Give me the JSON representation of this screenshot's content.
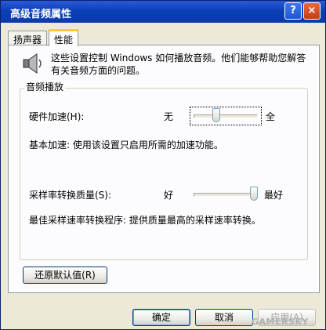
{
  "window": {
    "title": "高级音频属性",
    "help_button": "?",
    "close_button": "×"
  },
  "tabs": [
    {
      "label": "扬声器",
      "active": false
    },
    {
      "label": "性能",
      "active": true
    }
  ],
  "panel": {
    "description": "这些设置控制 Windows 如何播放音频。他们能够帮助您解答有关音频方面的问题。",
    "group_title": "音频播放",
    "hardware_accel": {
      "label": "硬件加速(H):",
      "min_label": "无",
      "max_label": "全",
      "level": 0.33,
      "status": "基本加速: 使用该设置只启用所需的加速功能。"
    },
    "sample_rate": {
      "label": "采样率转换质量(S):",
      "min_label": "好",
      "max_label": "最好",
      "level": 1.0,
      "status": "最佳采样速率转换程序: 提供质量最高的采样速率转换。"
    },
    "restore_defaults_label": "还原默认值(R)"
  },
  "footer": {
    "ok_label": "确定",
    "cancel_label": "取消",
    "apply_label": "应用(A)"
  },
  "watermark": "GAMERSKY"
}
